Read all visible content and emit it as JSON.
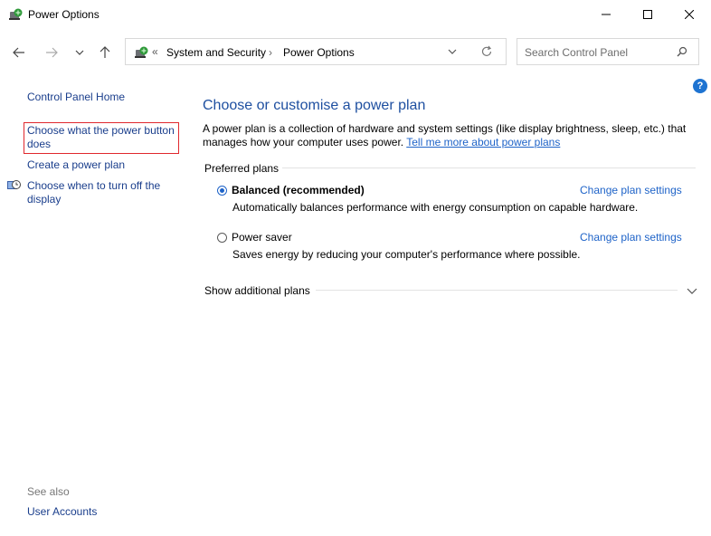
{
  "window": {
    "title": "Power Options"
  },
  "address": {
    "overflow": "«",
    "crumbs": [
      "System and Security",
      "Power Options"
    ]
  },
  "search": {
    "placeholder": "Search Control Panel"
  },
  "sidebar": {
    "home": "Control Panel Home",
    "items": [
      "Choose what the power button does",
      "Create a power plan",
      "Choose when to turn off the display"
    ],
    "see_also": "See also",
    "see_also_items": [
      "User Accounts"
    ]
  },
  "main": {
    "title": "Choose or customise a power plan",
    "intro": "A power plan is a collection of hardware and system settings (like display brightness, sleep, etc.) that manages how your computer uses power.",
    "intro_link": "Tell me more about power plans",
    "group_label": "Preferred plans",
    "plans": [
      {
        "name": "Balanced (recommended)",
        "selected": true,
        "description": "Automatically balances performance with energy consumption on capable hardware.",
        "change_label": "Change plan settings"
      },
      {
        "name": "Power saver",
        "selected": false,
        "description": "Saves energy by reducing your computer's performance where possible.",
        "change_label": "Change plan settings"
      }
    ],
    "additional": "Show additional plans"
  },
  "help": "?",
  "colors": {
    "link": "#1a3e8c",
    "accent": "#1e63c8",
    "highlight_border": "#e0282e"
  }
}
